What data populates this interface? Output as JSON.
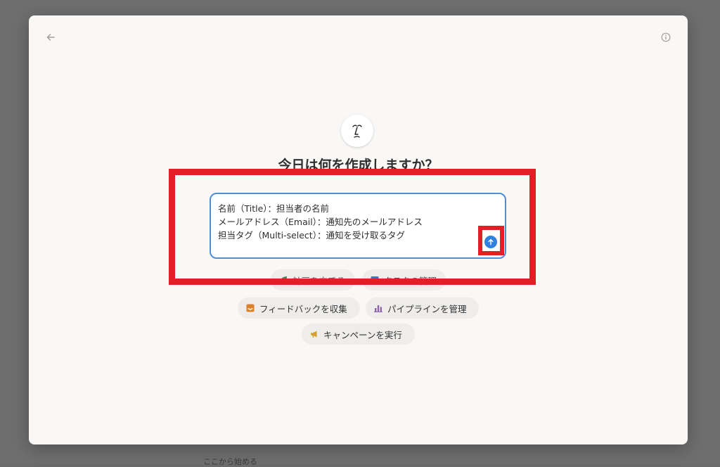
{
  "heading": "今日は何を作成しますか？",
  "prompt": {
    "lines": [
      "名前（Title）：担当者の名前",
      "メールアドレス（Email）：通知先のメールアドレス",
      "担当タグ（Multi-select）：通知を受け取るタグ"
    ]
  },
  "suggestions": [
    {
      "label": "計画を立てる",
      "icon": "leaf-icon",
      "color": "#3f8a5a"
    },
    {
      "label": "タスクの管理",
      "icon": "checklist-icon",
      "color": "#3b74c7"
    },
    {
      "label": "フィードバックを収集",
      "icon": "inbox-icon",
      "color": "#d9822b"
    },
    {
      "label": "パイプラインを管理",
      "icon": "bar-chart-icon",
      "color": "#9065b0"
    },
    {
      "label": "キャンペーンを実行",
      "icon": "megaphone-icon",
      "color": "#d4a12a"
    }
  ],
  "background": {
    "footer_text": "ここから始める"
  },
  "colors": {
    "highlight": "#e21f26",
    "send": "#2f80e0",
    "input_border": "#4a90d9"
  }
}
